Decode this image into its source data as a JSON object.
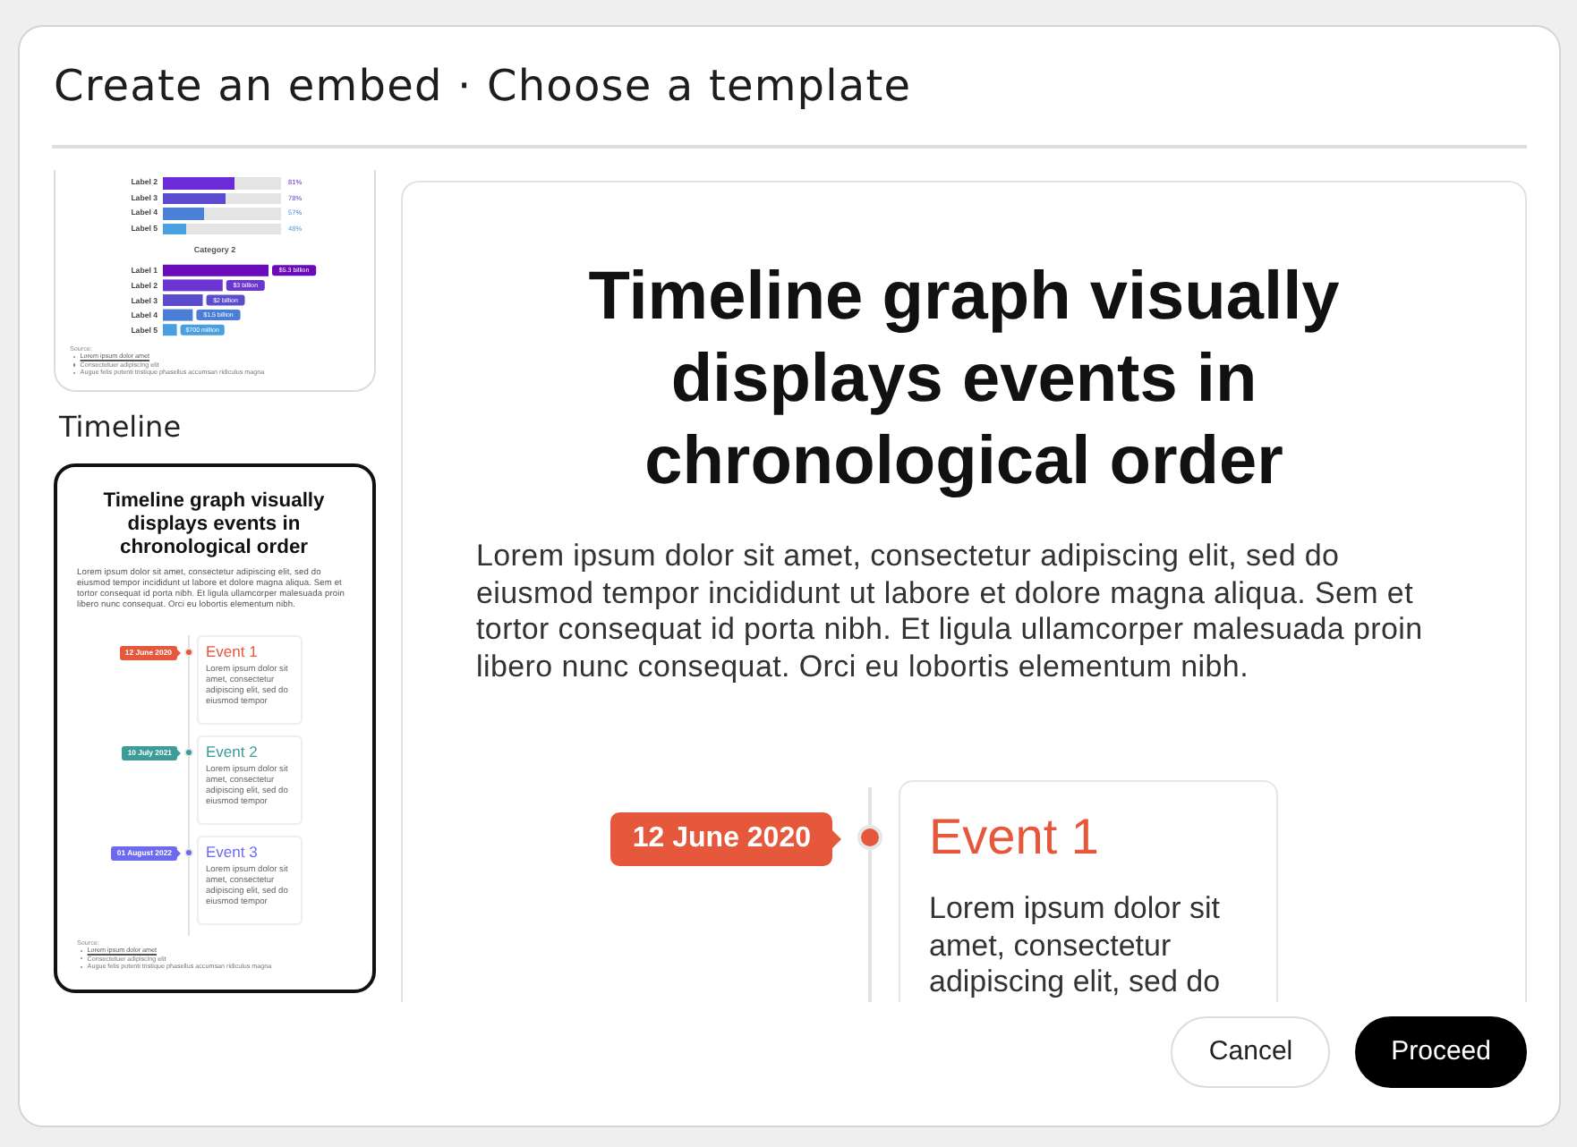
{
  "dialog": {
    "title": "Create an embed · Choose a template"
  },
  "templates": [
    {
      "kind": "bar-chart",
      "selected": false,
      "sections": [
        {
          "kind": "track",
          "bars": [
            {
              "label": "Label 2",
              "value": "81%",
              "level": 0.61,
              "color": "#6c2bd9"
            },
            {
              "label": "Label 3",
              "value": "78%",
              "level": 0.53,
              "color": "#5a4bd0"
            },
            {
              "label": "Label 4",
              "value": "57%",
              "level": 0.35,
              "color": "#4a80d8"
            },
            {
              "label": "Label 5",
              "value": "48%",
              "level": 0.2,
              "color": "#49a0e0"
            }
          ]
        },
        {
          "kind": "chart",
          "chart_data": {
            "type": "bar",
            "orientation": "horizontal",
            "title": "Category 2",
            "categories": [
              "Label 1",
              "Label 2",
              "Label 3",
              "Label 4",
              "Label 5"
            ],
            "values": [
              5300000000,
              3000000000,
              2000000000,
              1500000000,
              700000000
            ],
            "value_labels": [
              "$5.3 billion",
              "$3 billion",
              "$2 billion",
              "$1.5 billion",
              "$700 million"
            ]
          }
        }
      ],
      "source": {
        "label": "Source:",
        "items": [
          {
            "text": "Lorem ipsum dolor amet",
            "link": true
          },
          {
            "text": "Consectetuer adipiscing elit",
            "link": false
          },
          {
            "text": "Augue felis potenti tristique phasellus accumsan ridiculus magna",
            "link": false
          }
        ]
      }
    },
    {
      "kind": "timeline",
      "name": "Timeline",
      "selected": true,
      "title": "Timeline graph visually displays events in chronological order",
      "body": "Lorem ipsum dolor sit amet, consectetur adipiscing elit, sed do eiusmod tempor incididunt ut labore et dolore magna aliqua. Sem et tortor consequat id porta nibh. Et ligula ullamcorper malesuada proin libero nunc consequat. Orci eu lobortis elementum nibh.",
      "events": [
        {
          "date": "12 June 2020",
          "title": "Event 1",
          "text": "Lorem ipsum dolor sit amet, consectetur adipiscing elit, sed do eiusmod tempor",
          "color": "#e5583b"
        },
        {
          "date": "10 July 2021",
          "title": "Event 2",
          "text": "Lorem ipsum dolor sit amet, consectetur adipiscing elit, sed do eiusmod tempor",
          "color": "#3b9c98"
        },
        {
          "date": "01 August 2022",
          "title": "Event 3",
          "text": "Lorem ipsum dolor sit amet, consectetur adipiscing elit, sed do eiusmod tempor",
          "color": "#6e6af0"
        }
      ],
      "source": {
        "label": "Source:",
        "items": [
          {
            "text": "Lorem ipsum dolor amet",
            "link": true
          },
          {
            "text": "Consectetuer adipiscing elit",
            "link": false
          },
          {
            "text": "Augue felis potenti tristique phasellus accumsan ridiculus magna",
            "link": false
          }
        ]
      }
    }
  ],
  "preview": {
    "title": "Timeline graph visually displays events in chronological order",
    "body": "Lorem ipsum dolor sit amet, consectetur adipiscing elit, sed do eiusmod tempor incididunt ut labore et dolore magna aliqua. Sem et tortor consequat id porta nibh. Et ligula ullamcorper malesuada proin libero nunc consequat. Orci eu lobortis elementum nibh.",
    "events": [
      {
        "date": "12 June 2020",
        "title": "Event 1",
        "text": "Lorem ipsum dolor sit amet, consectetur adipiscing elit, sed do",
        "color": "#e5583b"
      }
    ]
  },
  "buttons": [
    {
      "label": "Cancel",
      "kind": "secondary"
    },
    {
      "label": "Proceed",
      "kind": "primary"
    }
  ]
}
